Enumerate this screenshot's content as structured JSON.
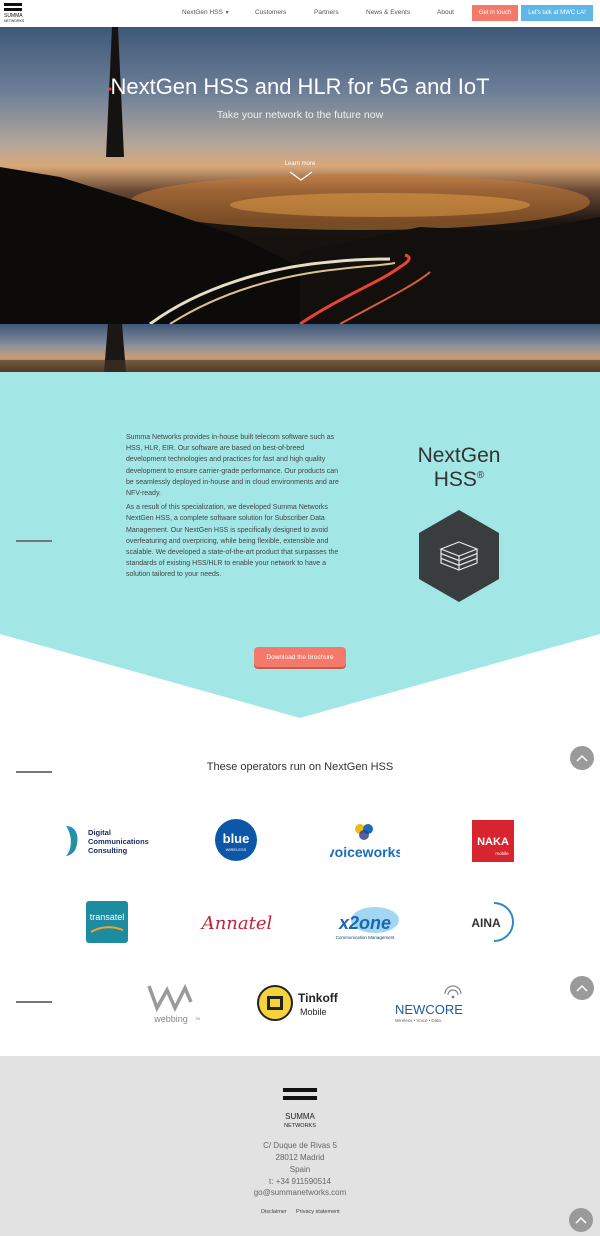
{
  "brand": {
    "name": "SUMMA",
    "sub": "NETWORKS"
  },
  "nav": {
    "items": [
      "NextGen HSS",
      "Customers",
      "Partners",
      "News & Events",
      "About"
    ],
    "dropdown_indicator": "chevron-down-icon",
    "cta_primary": "Get in touch",
    "cta_secondary": "Let's talk at MWC LA!"
  },
  "hero": {
    "title": "NextGen HSS and HLR for 5G and IoT",
    "subtitle": "Take your network to the future now",
    "learn_more": "Learn more"
  },
  "intro": {
    "paragraph1": "Summa Networks provides in-house built telecom software such as HSS, HLR, EIR. Our software are based on best-of-breed development technologies and practices for fast and high quality development to ensure carrier-grade performance. Our products can be seamlessly deployed in-house and in cloud environments and are NFV-ready.",
    "paragraph2": "As a result of this specialization, we developed Summa Networks NextGen HSS, a complete software solution for Subscriber Data Management. Our NextGen HSS is specifically designed to avoid overfeaturing and overpricing, while being flexible, extensible and scalable. We developed a state-of-the-art product that surpasses the standards of existing HSS/HLR to enable your network to have a solution tailored to your needs.",
    "product_line1": "NextGen",
    "product_line2": "HSS",
    "product_mark": "®",
    "brochure_button": "Download the brochure"
  },
  "operators": {
    "title": "These operators run on NextGen HSS",
    "logos": {
      "dcc1": "Digital",
      "dcc2": "Communications",
      "dcc3": "Consulting",
      "blue": "blue",
      "blue_sub": "WIRELESS",
      "voiceworks": "voiceworks",
      "naka": "NAKA",
      "naka_sub": "mobile",
      "transatel": "transatel",
      "annatel": "Annatel",
      "x2one": "x2one",
      "x2one_sub": "Communication Management",
      "aina": "AINA",
      "webbing": "webbing",
      "webbing_tm": "TM",
      "tinkoff1": "Tinkoff",
      "tinkoff2": "Mobile",
      "newcore": "NEWCORE",
      "newcore_sub": "Wireless • Voice • Data"
    }
  },
  "footer": {
    "name": "SUMMA",
    "sub": "NETWORKS",
    "address1": "C/ Duque de Rivas 5",
    "address2": "28012 Madrid",
    "country": "Spain",
    "phone": "t: +34 911590514",
    "email": "go@summanetworks.com",
    "disclaimer": "Disclaimer",
    "privacy": "Privacy statement"
  },
  "colors": {
    "accent_orange": "#f3796a",
    "accent_blue": "#5fb7e8",
    "intro_bg": "#a3e6e6",
    "footer_bg": "#e2e2e2"
  }
}
